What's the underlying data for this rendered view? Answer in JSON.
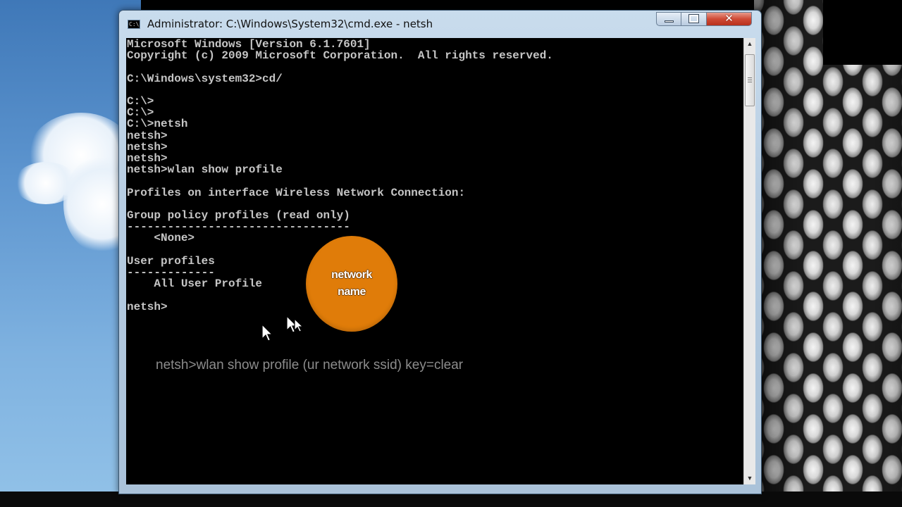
{
  "window": {
    "title": "Administrator: C:\\Windows\\System32\\cmd.exe - netsh",
    "icon": "cmd-icon",
    "controls": {
      "minimize": "minimize-icon",
      "maximize": "maximize-icon",
      "close": "close-icon"
    }
  },
  "console": {
    "lines": [
      "Microsoft Windows [Version 6.1.7601]",
      "Copyright (c) 2009 Microsoft Corporation.  All rights reserved.",
      "",
      "C:\\Windows\\system32>cd/",
      "",
      "C:\\>",
      "C:\\>",
      "C:\\>netsh",
      "netsh>",
      "netsh>",
      "netsh>",
      "netsh>wlan show profile",
      "",
      "Profiles on interface Wireless Network Connection:",
      "",
      "Group policy profiles (read only)",
      "---------------------------------",
      "    <None>",
      "",
      "User profiles",
      "-------------",
      "    All User Profile",
      "",
      "netsh>"
    ],
    "text_color": "#c6c6c6",
    "background": "#000000"
  },
  "overlay": {
    "badge_line1": "network",
    "badge_line2": "name",
    "badge_color": "#e07c09",
    "caption": "netsh>wlan show profile (ur network ssid) key=clear"
  }
}
